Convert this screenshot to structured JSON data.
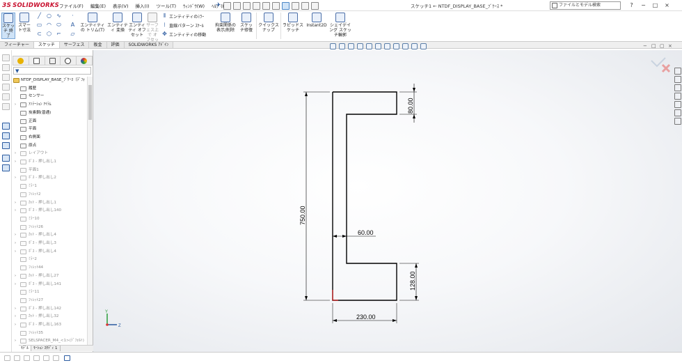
{
  "app": {
    "logo_mark": "3S",
    "logo_text": "SOLIDWORKS",
    "doc_title": "スケッチ1 ← NTDF_DISPLAY_BASE_ﾌﾞｹｰｽ *"
  },
  "menu": [
    "ファイル(F)",
    "編集(E)",
    "表示(V)",
    "挿入(I)",
    "ツール(T)",
    "ｳｨﾝﾄﾞｳ(W)",
    "ﾍﾙﾌﾟ(H)"
  ],
  "search": {
    "placeholder": "ファイルとモデル検索"
  },
  "window_controls": [
    "?",
    "−",
    "□",
    "×"
  ],
  "ribbon": {
    "sketch_exit": "スケッチ 終了",
    "smart_dim": "スマート寸法",
    "entity_trim": "エンティティの トリム(T)",
    "entity_convert": "エンティティ 変換",
    "entity_offset": "エンティティ オフセット",
    "surface_offset": "サーフェス上で オフセット",
    "mirror_entity": "エンティティのﾐﾗｰ",
    "linear_pattern": "直線パターン ｽｹｰﾙ",
    "move_entity": "エンティティの移動",
    "show_delete_rel": "拘束関係の 表示/削除",
    "repair_sketch": "スケッチ修復",
    "quick_snap": "クイックスナップ",
    "rapid_sketch": "ラピッドスケッチ",
    "instant2d": "Instant2D",
    "shaded_contours": "シェイデイング スケッチ輪郭"
  },
  "cm_tabs": [
    "フィーチャー",
    "スケッチ",
    "サーフェス",
    "板金",
    "評価",
    "SOLIDWORKS ｱﾄﾞｲﾝ"
  ],
  "tree": {
    "root": "NTDF_DISPLAY_BASE_ﾌﾞｹｰｽ（ﾃﾞﾌｫ",
    "items": [
      {
        "label": "履歴",
        "grey": false,
        "exp": true
      },
      {
        "label": "センサー",
        "grey": false,
        "exp": false
      },
      {
        "label": "ｱﾉﾃｰｼｮﾝ ｱｲﾃﾑ",
        "grey": false,
        "exp": true
      },
      {
        "label": "炭素鋼(普通)",
        "grey": false,
        "exp": false
      },
      {
        "label": "正面",
        "grey": false,
        "exp": false
      },
      {
        "label": "平面",
        "grey": false,
        "exp": false
      },
      {
        "label": "右側面",
        "grey": false,
        "exp": false
      },
      {
        "label": "原点",
        "grey": false,
        "exp": false
      },
      {
        "label": "レイアウト",
        "grey": true,
        "exp": true
      },
      {
        "label": "ﾎﾞｽ - 押し出し1",
        "grey": true,
        "exp": true
      },
      {
        "label": "平面1",
        "grey": true,
        "exp": false
      },
      {
        "label": "ﾎﾞｽ - 押し出し2",
        "grey": true,
        "exp": true
      },
      {
        "label": "ﾐﾗｰ1",
        "grey": true,
        "exp": false
      },
      {
        "label": "ﾌｨﾚｯﾄ2",
        "grey": true,
        "exp": false
      },
      {
        "label": "ｶｯﾄ - 押し出し1",
        "grey": true,
        "exp": true
      },
      {
        "label": "ﾎﾞｽ - 押し出し140",
        "grey": true,
        "exp": true
      },
      {
        "label": "ﾐﾗｰ10",
        "grey": true,
        "exp": false
      },
      {
        "label": "ﾌｨﾚｯﾄ26",
        "grey": true,
        "exp": false
      },
      {
        "label": "ｶｯﾄ - 押し出し4",
        "grey": true,
        "exp": true
      },
      {
        "label": "ﾎﾞｽ - 押し出し3",
        "grey": true,
        "exp": true
      },
      {
        "label": "ﾎﾞｽ - 押し出し4",
        "grey": true,
        "exp": true
      },
      {
        "label": "ﾐﾗｰ2",
        "grey": true,
        "exp": false
      },
      {
        "label": "ﾌｨﾚｯﾄ44",
        "grey": true,
        "exp": false
      },
      {
        "label": "ｶｯﾄ - 押し出し27",
        "grey": true,
        "exp": true
      },
      {
        "label": "ﾎﾞｽ - 押し出し141",
        "grey": true,
        "exp": true
      },
      {
        "label": "ﾐﾗｰ11",
        "grey": true,
        "exp": false
      },
      {
        "label": "ﾌｨﾚｯﾄ27",
        "grey": true,
        "exp": false
      },
      {
        "label": "ﾎﾞｽ - 押し出し142",
        "grey": true,
        "exp": true
      },
      {
        "label": "ｶｯﾄ - 押し出し32",
        "grey": true,
        "exp": true
      },
      {
        "label": "ﾎﾞｽ - 押し出し163",
        "grey": true,
        "exp": true
      },
      {
        "label": "ﾌｨﾚｯﾄ35",
        "grey": true,
        "exp": false
      },
      {
        "label": "SELSPACER_M4_<1>(ﾃﾞﾌｫﾙﾄ)",
        "grey": true,
        "exp": true
      }
    ]
  },
  "bottom_tabs": [
    "ﾓﾃﾞﾙ",
    "ﾓｰｼｮﾝ ｽﾀﾃﾞｨ 1"
  ],
  "dimensions": {
    "d_top": "80.00",
    "d_total": "750.00",
    "d_web": "60.00",
    "d_bottom": "128.00",
    "d_width": "230.00"
  },
  "triad": {
    "y": "Y",
    "z": "Z"
  }
}
